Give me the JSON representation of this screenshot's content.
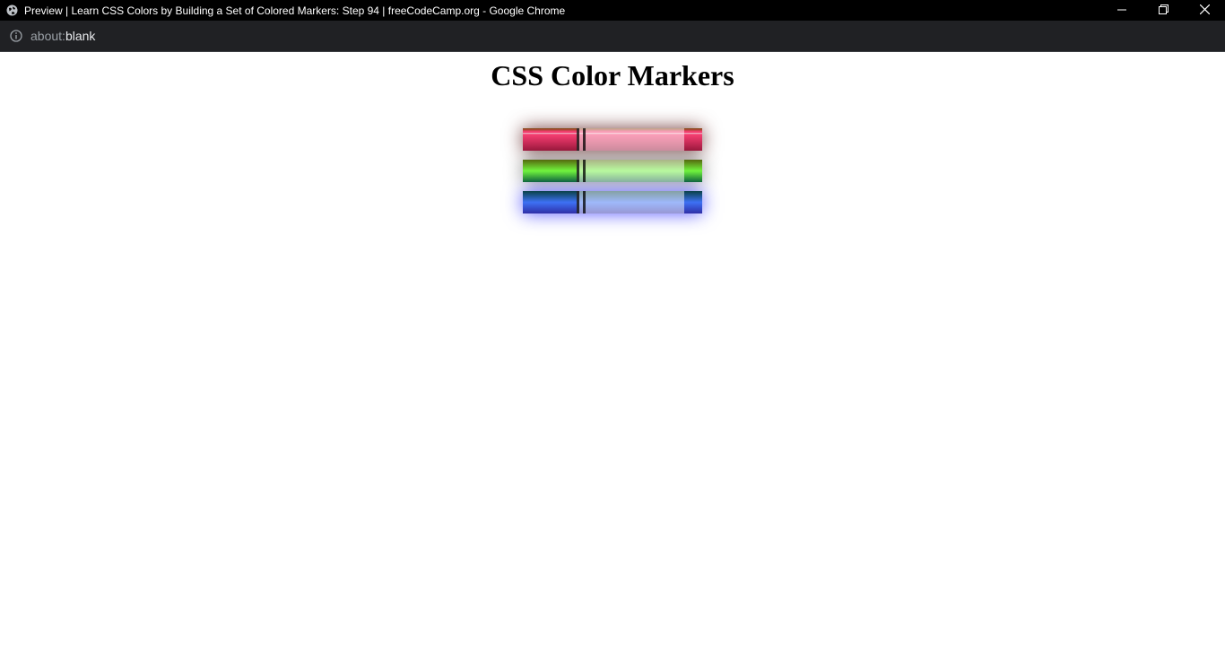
{
  "window": {
    "title": "Preview | Learn CSS Colors by Building a Set of Colored Markers: Step 94 | freeCodeCamp.org - Google Chrome",
    "icon": "globe-icon",
    "controls": [
      "minimize-icon",
      "restore-icon",
      "close-icon"
    ]
  },
  "address_bar": {
    "icon": "info-icon",
    "url_scheme": "about:",
    "url_host": "blank"
  },
  "page": {
    "heading": "CSS Color Markers",
    "markers": [
      {
        "name": "red",
        "icon": "marker"
      },
      {
        "name": "green",
        "icon": "marker"
      },
      {
        "name": "blue",
        "icon": "marker"
      }
    ]
  },
  "colors": {
    "titlebar_bg": "#000000",
    "addressbar_bg": "#202124",
    "page_bg": "#ffffff"
  }
}
